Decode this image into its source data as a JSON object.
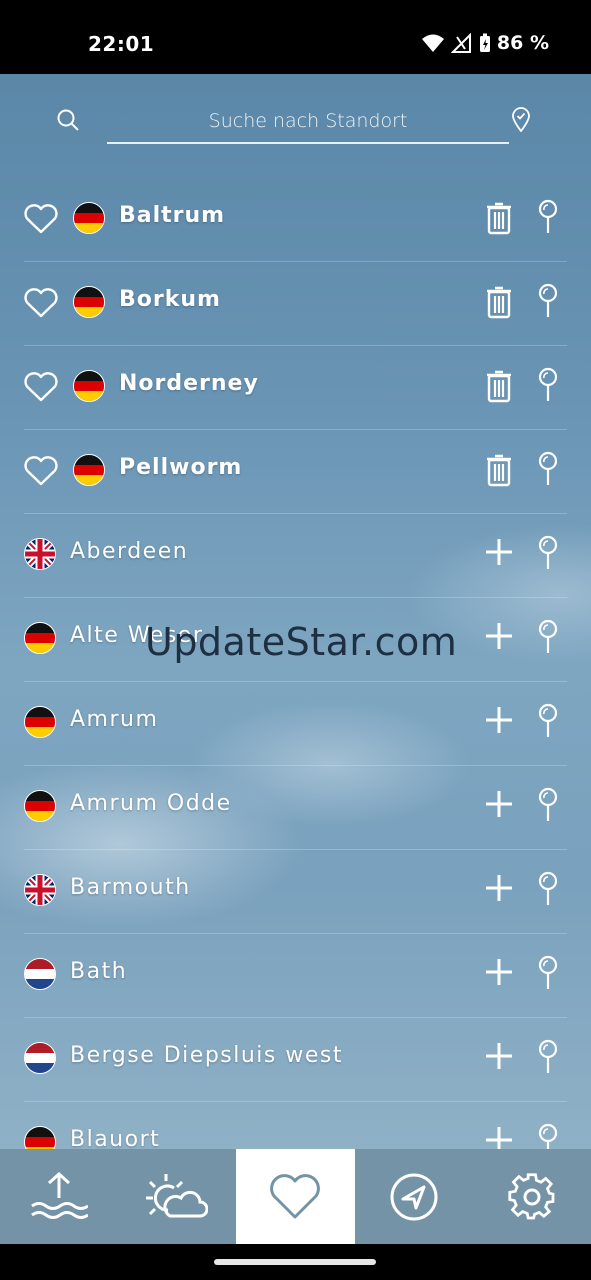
{
  "status": {
    "time": "22:01",
    "battery": "86 %"
  },
  "search": {
    "placeholder": "Suche nach Standort"
  },
  "favorites": [
    {
      "name": "Baltrum",
      "flag": "de"
    },
    {
      "name": "Borkum",
      "flag": "de"
    },
    {
      "name": "Norderney",
      "flag": "de"
    },
    {
      "name": "Pellworm",
      "flag": "de"
    }
  ],
  "locations": [
    {
      "name": "Aberdeen",
      "flag": "gb"
    },
    {
      "name": "Alte Weser",
      "flag": "de"
    },
    {
      "name": "Amrum",
      "flag": "de"
    },
    {
      "name": "Amrum Odde",
      "flag": "de"
    },
    {
      "name": "Barmouth",
      "flag": "gb"
    },
    {
      "name": "Bath",
      "flag": "nl"
    },
    {
      "name": "Bergse Diepsluis west",
      "flag": "nl"
    },
    {
      "name": "Blauort",
      "flag": "de"
    }
  ],
  "watermark": "UpdateStar.com",
  "nav": [
    {
      "id": "tides",
      "icon": "tide-icon"
    },
    {
      "id": "weather",
      "icon": "sun-cloud-icon"
    },
    {
      "id": "favorites",
      "icon": "heart-icon",
      "active": true
    },
    {
      "id": "navigate",
      "icon": "navigation-icon"
    },
    {
      "id": "settings",
      "icon": "gear-icon"
    }
  ],
  "colors": {
    "nav_bg": "#7593a6",
    "accent": "#ffffff"
  }
}
